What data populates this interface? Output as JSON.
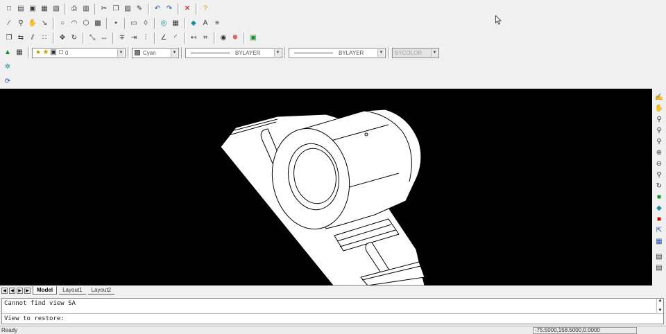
{
  "toolbar": {
    "row1_icons": [
      "new-icon",
      "open-icon",
      "save-icon",
      "plot-preview-icon",
      "publish-icon",
      "|",
      "print-icon",
      "preview-icon",
      "|",
      "cut-icon",
      "copy-icon",
      "paste-icon",
      "match-properties-icon",
      "|",
      "undo-icon",
      "redo-icon",
      "|",
      "close-icon",
      "|",
      "help-icon"
    ],
    "row2_icons": [
      "line-icon",
      "zoom-realtime-icon",
      "pan-icon",
      "measure-icon",
      "|",
      "circle-icon",
      "arc-icon",
      "polygon-icon",
      "hatch-icon",
      "|",
      "point-icon",
      "|",
      "rectangle-icon",
      "region-icon",
      "|",
      "ring-icon",
      "table-icon",
      "|",
      "solid-icon",
      "text-icon",
      "mtext-icon"
    ],
    "row3_icons": [
      "copy-object-icon",
      "mirror-icon",
      "offset-icon",
      "array-icon",
      "|",
      "move-icon",
      "rotate-icon",
      "|",
      "scale-icon",
      "stretch-icon",
      "|",
      "trim-icon",
      "extend-icon",
      "break-icon",
      "|",
      "chamfer-icon",
      "fillet-icon",
      "|",
      "dimension-icon",
      "align-icon",
      "|",
      "layer-off-icon",
      "layer-freeze-icon",
      "|",
      "block-icon"
    ],
    "layer_value": "0",
    "color_value": "Cyan",
    "linetype_value": "BYLAYER",
    "lineweight_value": "BYLAYER",
    "plotstyle_value": "BYCOLOR"
  },
  "tabs": [
    {
      "label": "Model",
      "active": true
    },
    {
      "label": "Layout1",
      "active": false
    },
    {
      "label": "Layout2",
      "active": false
    }
  ],
  "command": {
    "history_line": "Cannot find view SA",
    "prompt_line": "View to restore:"
  },
  "status": {
    "text": "Ready",
    "coordinates": "-75.5000,158.5000,0.0000"
  },
  "colors": {
    "viewport_bg": "#000000",
    "model_fill": "#ffffff",
    "model_stroke": "#000000"
  }
}
